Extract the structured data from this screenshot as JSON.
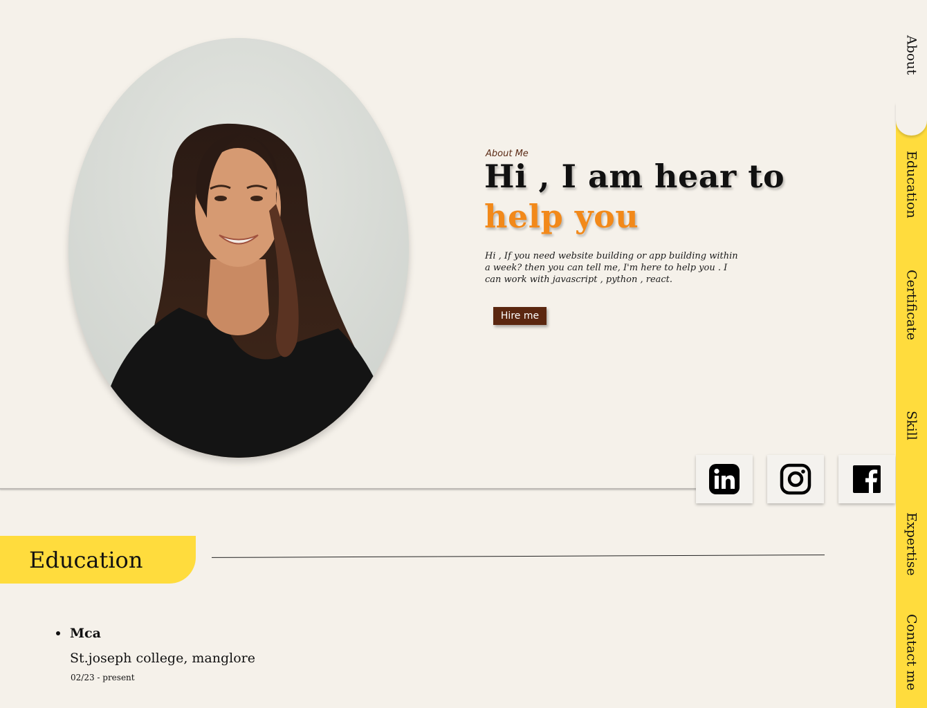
{
  "hero": {
    "label": "About Me",
    "headline_line1": "Hi , I am hear to",
    "headline_line2": "help you",
    "intro": "Hi , If you need website building or app building within a week? then you can tell me, I'm here to help you . I can work with javascript , python , react.",
    "cta_label": "Hire me"
  },
  "social": [
    {
      "name": "linkedin",
      "icon": "linkedin-icon"
    },
    {
      "name": "instagram",
      "icon": "instagram-icon"
    },
    {
      "name": "facebook",
      "icon": "facebook-icon"
    }
  ],
  "nav": {
    "items": [
      {
        "label": "About"
      },
      {
        "label": "Education"
      },
      {
        "label": "Certificate"
      },
      {
        "label": "Skill"
      },
      {
        "label": "Expertise"
      },
      {
        "label": "Contact me"
      }
    ]
  },
  "education": {
    "title": "Education",
    "entries": [
      {
        "degree": "Mca",
        "institution": "St.joseph college, manglore",
        "period": "02/23 - present"
      }
    ]
  },
  "colors": {
    "background": "#f5f1ea",
    "accent_yellow": "#ffdc3d",
    "accent_orange": "#f2891a",
    "button_brown": "#5b2710"
  }
}
